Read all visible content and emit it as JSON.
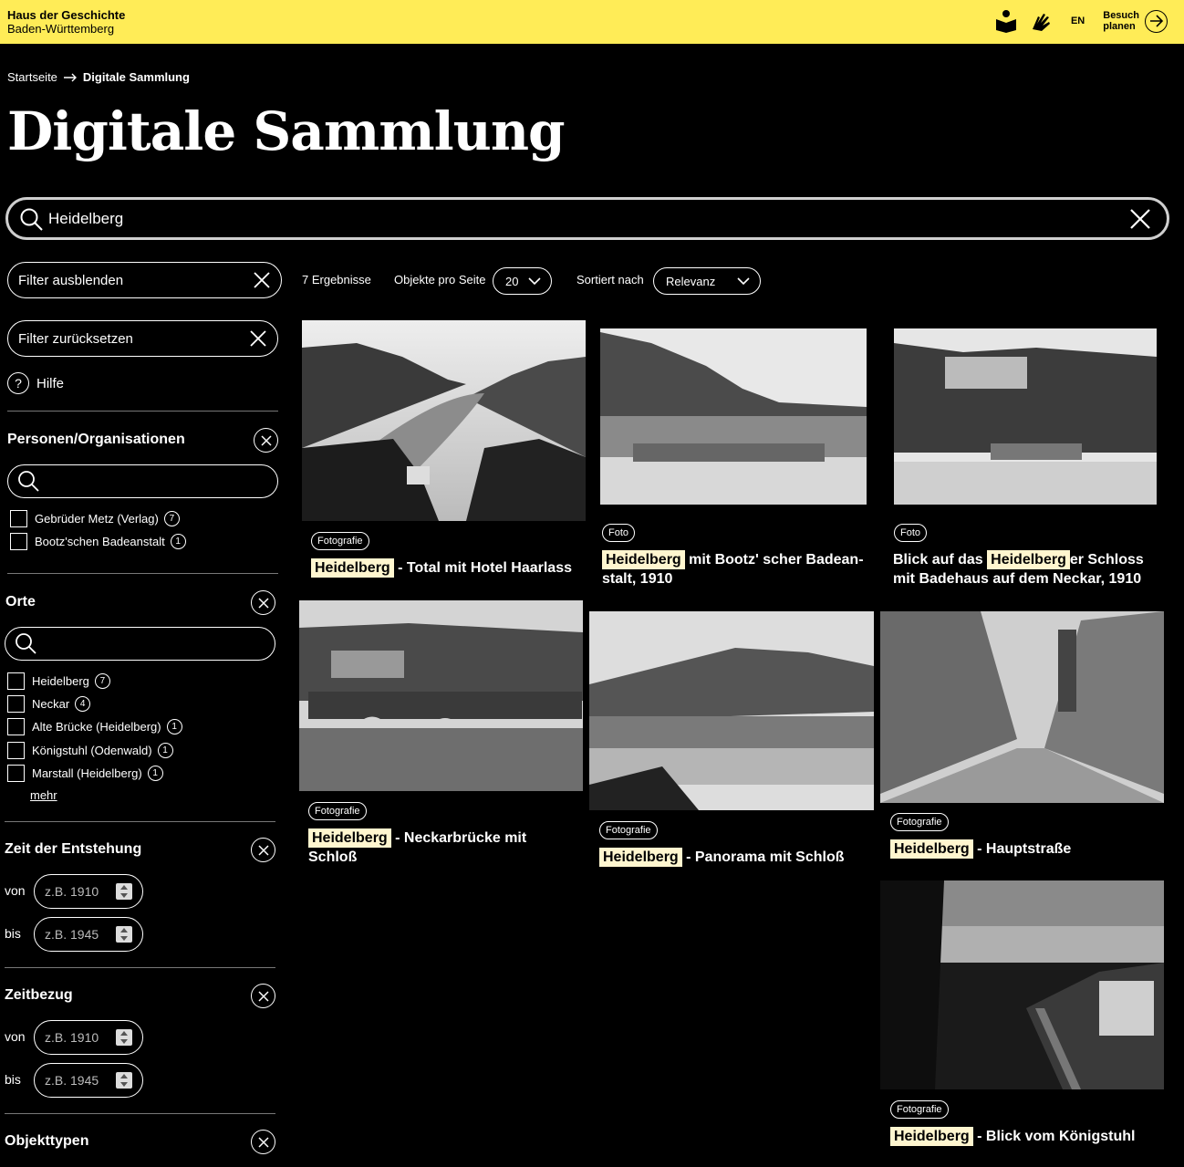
{
  "header": {
    "brand_line1": "Haus der Geschichte",
    "brand_line2": "Baden-Württemberg",
    "lang": "EN",
    "visit_line1": "Besuch",
    "visit_line2": "planen",
    "accent": "#ffec57"
  },
  "breadcrumb": {
    "home": "Startseite",
    "current": "Digitale Sammlung"
  },
  "page_title": "Digitale Sammlung",
  "search": {
    "value": "Heidelberg"
  },
  "sidebar": {
    "hide_filter": "Filter ausblenden",
    "reset_filter": "Filter zurücksetzen",
    "help": "Hilfe",
    "persons": {
      "title": "Personen/Organisationen",
      "items": [
        {
          "label": "Gebrüder Metz (Verlag)",
          "count": "7"
        },
        {
          "label": "Bootz'schen Badeanstalt",
          "count": "1"
        }
      ]
    },
    "places": {
      "title": "Orte",
      "items": [
        {
          "label": "Heidelberg",
          "count": "7"
        },
        {
          "label": "Neckar",
          "count": "4"
        },
        {
          "label": "Alte Brücke (Heidelberg)",
          "count": "1"
        },
        {
          "label": "Königstuhl (Odenwald)",
          "count": "1"
        },
        {
          "label": "Marstall (Heidelberg)",
          "count": "1"
        }
      ],
      "more": "mehr"
    },
    "creation_time": {
      "title": "Zeit der Entstehung",
      "from_label": "von",
      "to_label": "bis",
      "from_placeholder": "z.B. 1910",
      "to_placeholder": "z.B. 1945"
    },
    "time_ref": {
      "title": "Zeitbezug",
      "from_label": "von",
      "to_label": "bis",
      "from_placeholder": "z.B. 1910",
      "to_placeholder": "z.B. 1945"
    },
    "object_types": {
      "title": "Objekttypen"
    }
  },
  "toolbar": {
    "results": "7 Ergebnisse",
    "per_page_label": "Objekte pro Seite",
    "per_page_value": "20",
    "sort_label": "Sortiert nach",
    "sort_value": "Relevanz"
  },
  "results": [
    {
      "badge": "Fotografie",
      "highlight": "Heidelberg",
      "title_rest": " - Total mit Hotel Haarlass"
    },
    {
      "badge": "Foto",
      "highlight": "Heidelberg",
      "title_rest": " mit Bootz' scher Badean-stalt, 1910"
    },
    {
      "badge": "Foto",
      "title_pre": "Blick auf das ",
      "highlight": "Heidelberg",
      "title_rest": "er Schloss mit Badehaus auf dem Neckar, 1910"
    },
    {
      "badge": "Fotografie",
      "highlight": "Heidelberg",
      "title_rest": " - Neckarbrücke mit Schloß"
    },
    {
      "badge": "Fotografie",
      "highlight": "Heidelberg",
      "title_rest": " - Panorama mit Schloß"
    },
    {
      "badge": "Fotografie",
      "highlight": "Heidelberg",
      "title_rest": " - Hauptstraße"
    },
    {
      "badge": "Fotografie",
      "highlight": "Heidelberg",
      "title_rest": " - Blick vom Königstuhl"
    }
  ]
}
